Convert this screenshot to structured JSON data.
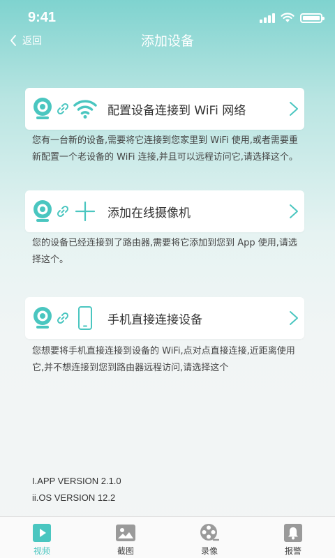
{
  "status_bar": {
    "time": "9:41"
  },
  "nav": {
    "back_label": "返回",
    "title": "添加设备"
  },
  "options": [
    {
      "label": "配置设备连接到 WiFi 网络",
      "description": "您有一台新的设备,需要将它连接到您家里到 WiFi 使用,或者需要重新配置一个老设备的 WiFi 连接,并且可以远程访问它,请选择这个。"
    },
    {
      "label": "添加在线摄像机",
      "description": "您的设备已经连接到了路由器,需要将它添加到您到 App 使用,请选择这个。"
    },
    {
      "label": "手机直接连接设备",
      "description": "您想要将手机直接连接到设备的 WiFi,点对点直接连接,近距离使用它,并不想连接到您到路由器远程访问,请选择这个"
    }
  ],
  "versions": {
    "app": "I.APP VERSION 2.1.0",
    "os": "ii.OS VERSION 12.2"
  },
  "tabs": [
    {
      "label": "视频",
      "icon": "video-play-icon",
      "active": true
    },
    {
      "label": "截图",
      "icon": "image-icon",
      "active": false
    },
    {
      "label": "录像",
      "icon": "film-reel-icon",
      "active": false
    },
    {
      "label": "报警",
      "icon": "bell-icon",
      "active": false
    }
  ],
  "colors": {
    "accent": "#4ac6c0",
    "tab_inactive": "#9a9a9a"
  }
}
